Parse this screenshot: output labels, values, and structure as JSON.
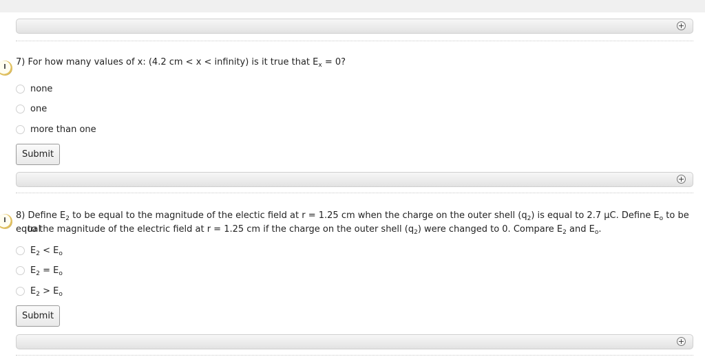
{
  "questions": [
    {
      "prefix": "7) For how many values of x: (4.2 cm < x < infinity) is it true that E",
      "sub": "x",
      "suffix": " = 0?",
      "options": [
        "none",
        "one",
        "more than one"
      ],
      "submit": "Submit"
    },
    {
      "line1": {
        "a": "8) Define E",
        "a_sub": "2",
        "b": " to be equal to the magnitude of the electic field at r = 1.25 cm when the charge on the outer shell (q",
        "b_sub": "2",
        "c": ") is equal to 2.7 μC. Define E",
        "c_sub": "o",
        "d": " to be equal"
      },
      "line2": {
        "a": "to the magnitude of the electric field at r = 1.25 cm if the charge on the outer shell (q",
        "a_sub": "2",
        "b": ") were changed to 0. Compare E",
        "b_sub": "2",
        "c": " and E",
        "c_sub": "o",
        "d": "."
      },
      "options": [
        {
          "e1": "E",
          "s1": "2",
          "op": " < E",
          "s2": "o"
        },
        {
          "e1": "E",
          "s1": "2",
          "op": " = E",
          "s2": "o"
        },
        {
          "e1": "E",
          "s1": "2",
          "op": " > E",
          "s2": "o"
        }
      ],
      "submit": "Submit"
    }
  ],
  "icons": {
    "expand": "+",
    "timer": "clock-icon"
  }
}
